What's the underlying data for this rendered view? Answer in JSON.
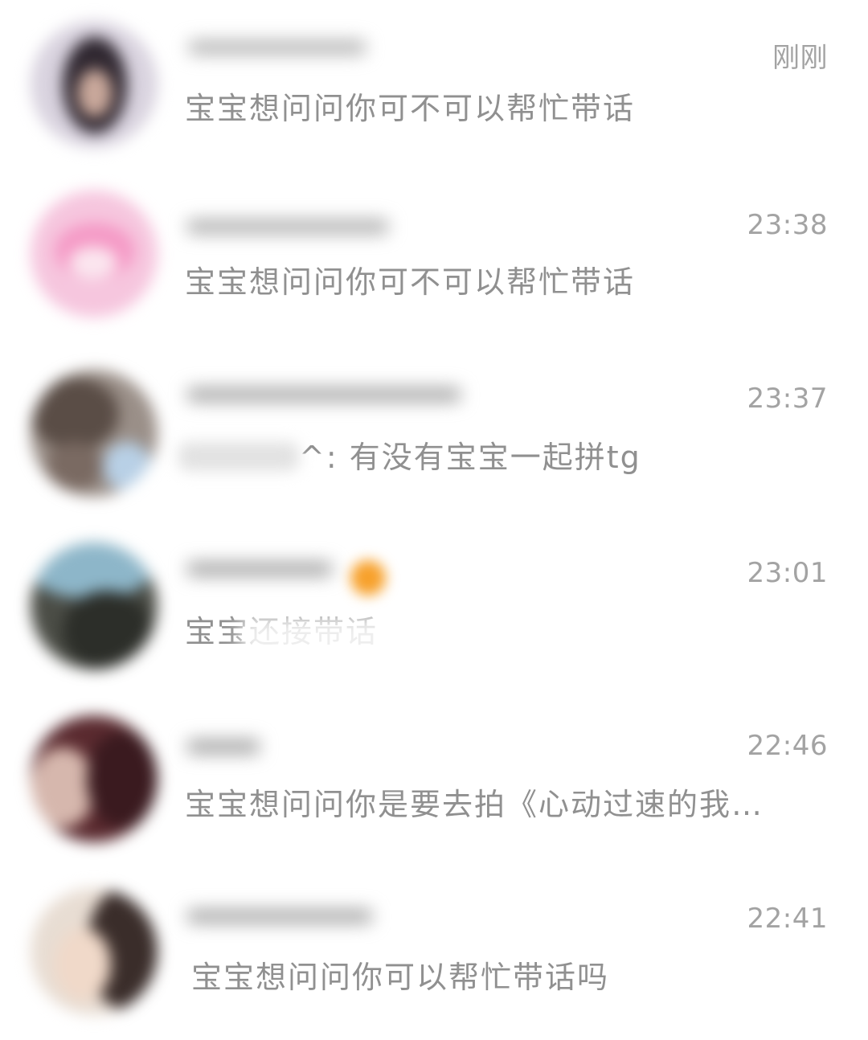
{
  "conversations": [
    {
      "time": "刚刚",
      "message": "宝宝想问问你可不可以帮忙带话"
    },
    {
      "time": "23:38",
      "message": "宝宝想问问你可不可以帮忙带话"
    },
    {
      "time": "23:37",
      "message_prefix": "^:",
      "message": " 有没有宝宝一起拼tg"
    },
    {
      "time": "23:01",
      "message": "宝宝还接带话"
    },
    {
      "time": "22:46",
      "message": "宝宝想问问你是要去拍《心动过速的我…"
    },
    {
      "time": "22:41",
      "message": "宝宝想问问你可以帮忙带话吗"
    }
  ],
  "colors": {
    "time_text": "#a3a3a3",
    "message_text": "#909090",
    "badge": "#f7a12c",
    "background": "#ffffff"
  }
}
